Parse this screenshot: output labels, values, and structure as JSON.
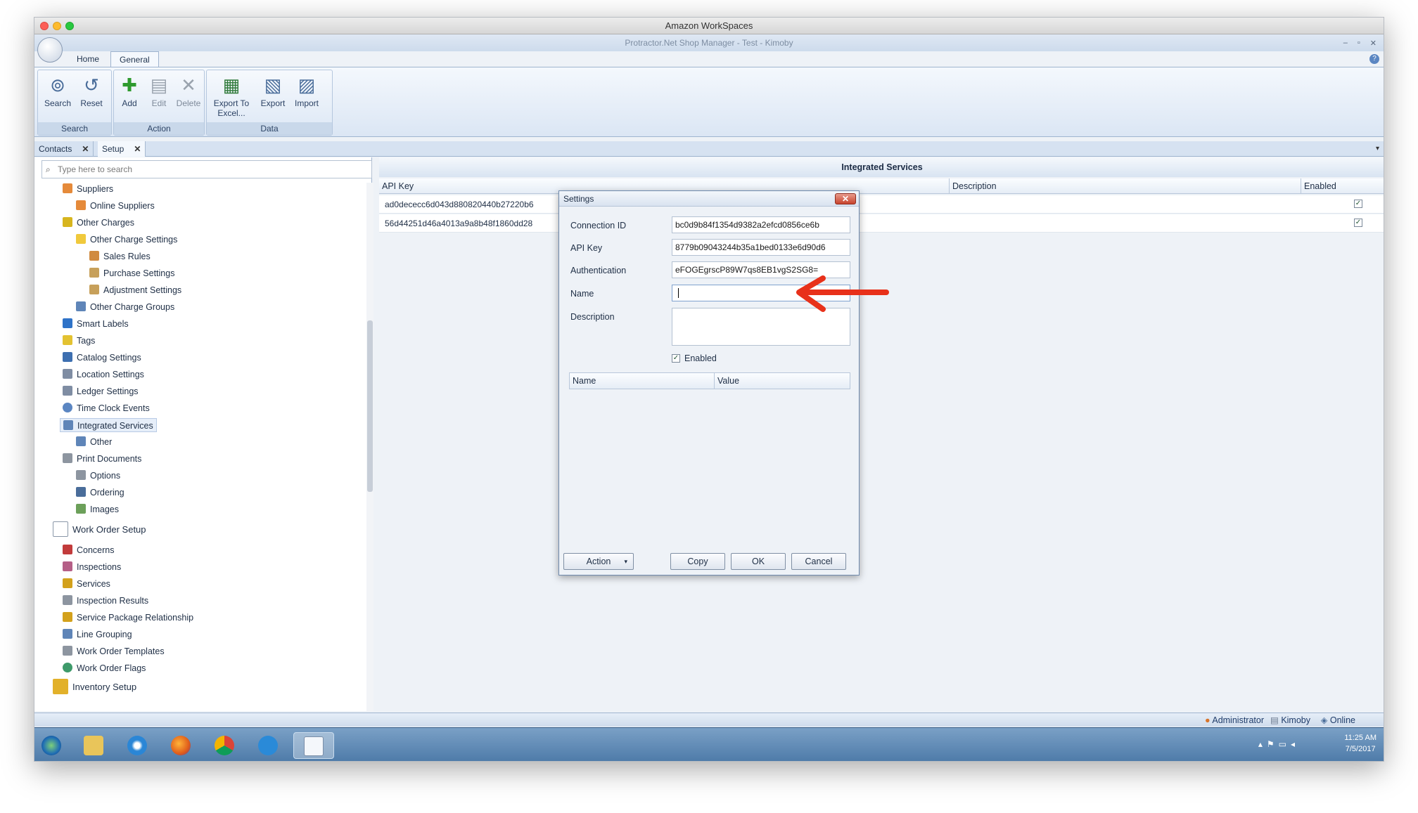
{
  "mac_window": {
    "title": "Amazon WorkSpaces"
  },
  "app": {
    "title": "Protractor.Net Shop Manager - Test - Kimoby"
  },
  "ribbon": {
    "tabs": [
      {
        "label": "Home"
      },
      {
        "label": "General"
      }
    ],
    "groups": [
      {
        "caption": "Search",
        "buttons": [
          {
            "label": "Search"
          },
          {
            "label": "Reset"
          }
        ]
      },
      {
        "caption": "Action",
        "buttons": [
          {
            "label": "Add"
          },
          {
            "label": "Edit"
          },
          {
            "label": "Delete"
          }
        ]
      },
      {
        "caption": "Data",
        "buttons": [
          {
            "label": "Export To Excel..."
          },
          {
            "label": "Export"
          },
          {
            "label": "Import"
          }
        ]
      }
    ]
  },
  "doc_tabs": [
    {
      "label": "Contacts"
    },
    {
      "label": "Setup"
    }
  ],
  "search": {
    "placeholder": "Type here to search"
  },
  "tree": [
    {
      "label": "Suppliers"
    },
    {
      "label": "Online Suppliers"
    },
    {
      "label": "Other Charges"
    },
    {
      "label": "Other Charge Settings"
    },
    {
      "label": "Sales Rules"
    },
    {
      "label": "Purchase Settings"
    },
    {
      "label": "Adjustment Settings"
    },
    {
      "label": "Other Charge Groups"
    },
    {
      "label": "Smart Labels"
    },
    {
      "label": "Tags"
    },
    {
      "label": "Catalog Settings"
    },
    {
      "label": "Location Settings"
    },
    {
      "label": "Ledger Settings"
    },
    {
      "label": "Time Clock Events"
    },
    {
      "label": "Integrated Services"
    },
    {
      "label": "Other"
    },
    {
      "label": "Print Documents"
    },
    {
      "label": "Options"
    },
    {
      "label": "Ordering"
    },
    {
      "label": "Images"
    },
    {
      "label": "Work Order Setup"
    },
    {
      "label": "Concerns"
    },
    {
      "label": "Inspections"
    },
    {
      "label": "Services"
    },
    {
      "label": "Inspection Results"
    },
    {
      "label": "Service Package Relationship"
    },
    {
      "label": "Line Grouping"
    },
    {
      "label": "Work Order Templates"
    },
    {
      "label": "Work Order Flags"
    },
    {
      "label": "Inventory Setup"
    }
  ],
  "integrated_services": {
    "title": "Integrated Services",
    "columns": [
      "API Key",
      "Description",
      "Enabled"
    ],
    "rows": [
      {
        "api_key": "ad0dececc6d043d880820440b27220b6",
        "description": "",
        "enabled": "✓"
      },
      {
        "api_key": "56d44251d46a4013a9a8b48f1860dd28",
        "description": "",
        "enabled": "✓"
      }
    ]
  },
  "settings_dialog": {
    "title": "Settings",
    "close_glyph": "✕",
    "fields": [
      {
        "label": "Connection ID",
        "value": "bc0d9b84f1354d9382a2efcd0856ce6b"
      },
      {
        "label": "API Key",
        "value": "8779b09043244b35a1bed0133e6d90d6"
      },
      {
        "label": "Authentication",
        "value": "eFOGEgrscP89W7qs8EB1vgS2SG8="
      },
      {
        "label": "Name",
        "value": ""
      },
      {
        "label": "Description",
        "value": ""
      }
    ],
    "enabled_label": "Enabled",
    "enabled_mark": "✓",
    "grid_columns": [
      "Name",
      "Value"
    ],
    "buttons": {
      "action": "Action",
      "copy": "Copy",
      "ok": "OK",
      "cancel": "Cancel"
    }
  },
  "status_bar": {
    "user": "Administrator",
    "company": "Kimoby",
    "connection": "Online"
  },
  "taskbar": {
    "time": "11:25 AM",
    "date": "7/5/2017"
  },
  "colors": {
    "annotation_arrow": "#e8311a",
    "ribbon_blue": "#dbe6f4",
    "selection": "#e6eef9"
  }
}
